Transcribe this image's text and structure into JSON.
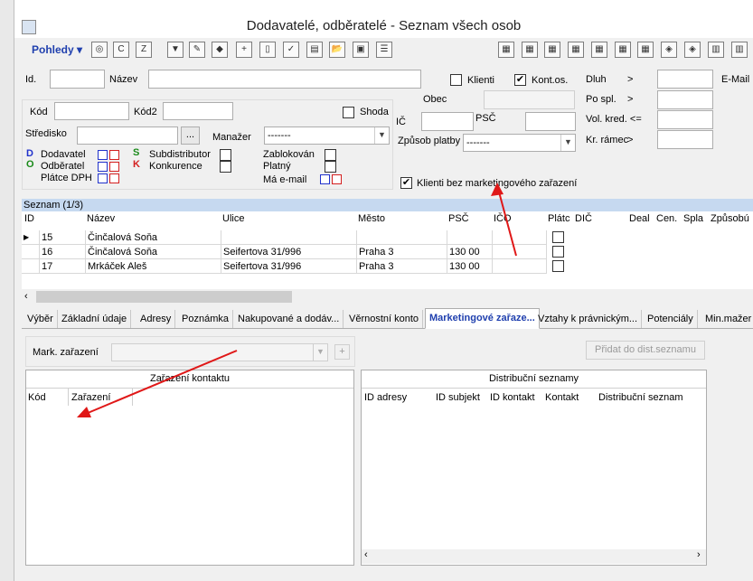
{
  "window": {
    "title": "Dodavatelé, odběratelé - Seznam všech osob"
  },
  "toolbar": {
    "pohledy_label": "Pohledy"
  },
  "filters": {
    "id_label": "Id.",
    "nazev_label": "Název",
    "kod_label": "Kód",
    "kod2_label": "Kód2",
    "shoda_label": "Shoda",
    "stredisko_label": "Středisko",
    "dots_label": "...",
    "manazer_label": "Manažer",
    "manazer_value": "-------",
    "dodavatel_label": "Dodavatel",
    "dodavatel_letter": "D",
    "odberatel_label": "Odběratel",
    "odberatel_letter": "O",
    "platce_dph_label": "Plátce DPH",
    "subdistributor_label": "Subdistributor",
    "subdistributor_letter": "S",
    "konkurence_label": "Konkurence",
    "konkurence_letter": "K",
    "zablokovan_label": "Zablokován",
    "platny_label": "Platný",
    "ma_email_label": "Má e-mail",
    "klienti_label": "Klienti",
    "kont_os_label": "Kont.os.",
    "obec_label": "Obec",
    "ic_label": "IČ",
    "psc_label": "PSČ",
    "zpusob_platby_label": "Způsob platby",
    "zpusob_platby_value": "-------",
    "klienti_bez_label": "Klienti bez marketingového zařazení",
    "dluh_label": "Dluh",
    "po_spl_label": "Po spl.",
    "vol_kred_label": "Vol. kred. <=",
    "kr_ramec_label": "Kr. rámec",
    "gt": ">",
    "email_label": "E-Mail"
  },
  "grid": {
    "title": "Seznam (1/3)",
    "columns": [
      "ID",
      "Název",
      "Ulice",
      "Město",
      "PSČ",
      "IČO",
      "Plátc",
      "DIČ",
      "Deal",
      "Cen.",
      "Spla",
      "Způsobú"
    ],
    "rows": [
      {
        "id": "15",
        "nazev": "Činčalová Soňa",
        "ulice": "",
        "mesto": "",
        "psc": ""
      },
      {
        "id": "16",
        "nazev": "Činčalová Soňa",
        "ulice": "Seifertova 31/996",
        "mesto": "Praha 3",
        "psc": "130 00"
      },
      {
        "id": "17",
        "nazev": "Mrkáček  Aleš",
        "ulice": "Seifertova 31/996",
        "mesto": "Praha 3",
        "psc": "130 00"
      }
    ]
  },
  "tabs": [
    "Výběr",
    "Základní údaje",
    "Adresy",
    "Poznámka",
    "Nakupované a dodáv...",
    "Věrnostní konto",
    "Marketingové zařaze...",
    "Vztahy k právnickým...",
    "Potenciály",
    "Min.mažer"
  ],
  "marketing": {
    "mark_zarazeni_label": "Mark. zařazení",
    "plus_label": "+",
    "pridat_label": "Přidat do dist.seznamu",
    "zarazeni_title": "Zařazení kontaktu",
    "zarazeni_cols": [
      "Kód",
      "Zařazení"
    ],
    "distribucni_title": "Distribuční seznamy",
    "distribucni_cols": [
      "ID adresy",
      "ID subjekt",
      "ID kontakt",
      "Kontakt",
      "Distribuční seznam"
    ]
  },
  "colors": {
    "accent_blue": "#1f3fae",
    "grid_header": "#c6d9f0",
    "annotation_red": "#e01818"
  }
}
